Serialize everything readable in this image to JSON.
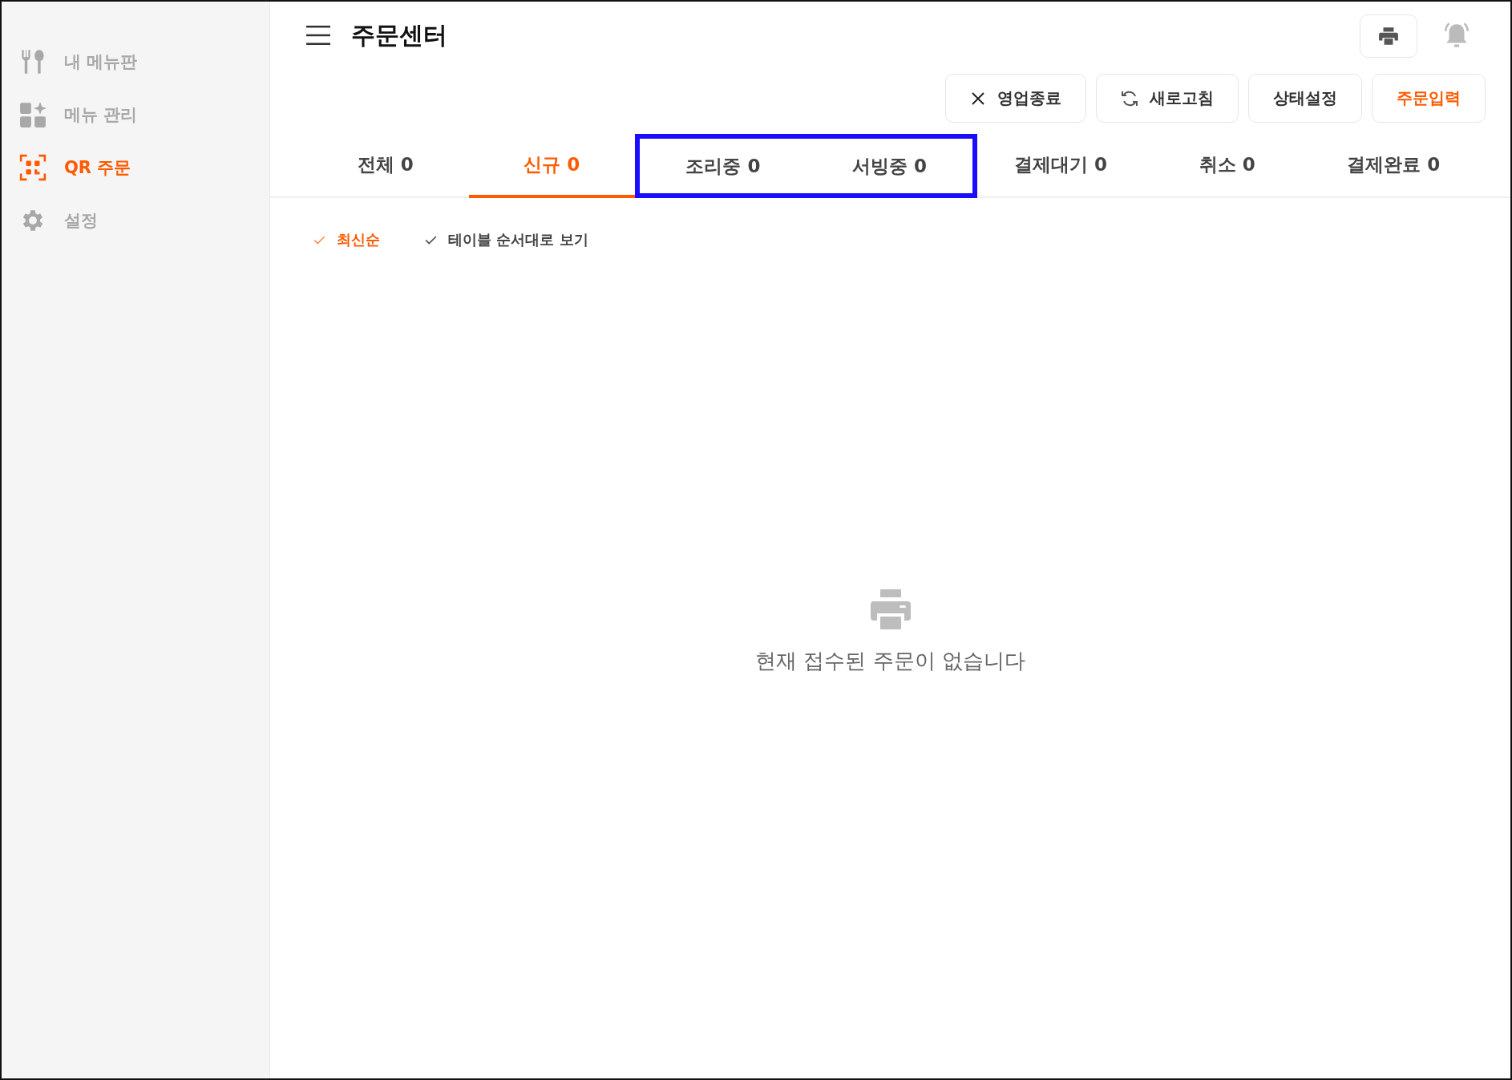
{
  "sidebar": {
    "items": [
      {
        "label": "내 메뉴판",
        "kind": "utensils",
        "selected": false
      },
      {
        "label": "메뉴 관리",
        "kind": "grid",
        "selected": false
      },
      {
        "label": "QR 주문",
        "kind": "qr",
        "selected": true
      },
      {
        "label": "설정",
        "kind": "gear",
        "selected": false
      }
    ]
  },
  "header": {
    "title": "주문센터"
  },
  "actions": [
    {
      "label": "영업종료",
      "kind": "close"
    },
    {
      "label": "새로고침",
      "kind": "refresh"
    },
    {
      "label": "상태설정",
      "kind": "plain"
    },
    {
      "label": "주문입력",
      "kind": "primary"
    }
  ],
  "tabs": [
    {
      "label": "전체 0",
      "selected": false,
      "highlighted": false
    },
    {
      "label": "신규 0",
      "selected": true,
      "highlighted": false
    },
    {
      "label": "조리중 0",
      "selected": false,
      "highlighted": true
    },
    {
      "label": "서빙중 0",
      "selected": false,
      "highlighted": true
    },
    {
      "label": "결제대기 0",
      "selected": false,
      "highlighted": false
    },
    {
      "label": "취소 0",
      "selected": false,
      "highlighted": false
    },
    {
      "label": "결제완료 0",
      "selected": false,
      "highlighted": false
    }
  ],
  "sort_options": [
    {
      "label": "최신순",
      "selected": true
    },
    {
      "label": "테이블 순서대로 보기",
      "selected": false
    }
  ],
  "empty_state": {
    "message": "현재 접수된 주문이 없습니다"
  }
}
